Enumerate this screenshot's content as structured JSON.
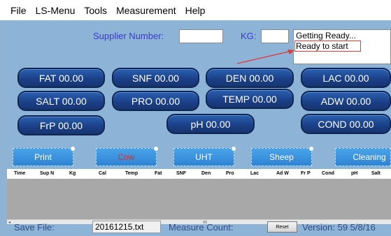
{
  "menu": {
    "items": [
      "File",
      "LS-Menu",
      "Tools",
      "Measurement",
      "Help"
    ]
  },
  "form": {
    "supplier_label": "Supplier Number:",
    "supplier_value": "",
    "kg_label": "KG:",
    "kg_value": ""
  },
  "status": {
    "line1": "Getting Ready...",
    "line2": "Ready to start"
  },
  "readings": {
    "fat": "FAT 00.00",
    "snf": "SNF 00.00",
    "den": "DEN 00.00",
    "lac": "LAC 00.00",
    "salt": "SALT 00.00",
    "pro": "PRO 00.00",
    "temp": "TEMP 00.00",
    "adw": "ADW 00.00",
    "frp": "FrP 00.00",
    "ph": "pH 00.00",
    "cond": "COND 00.00"
  },
  "toolbar": {
    "print": "Print",
    "cow": "Cow",
    "uht": "UHT",
    "sheep": "Sheep",
    "cleaning": "Cleaning"
  },
  "table": {
    "columns": [
      "Time",
      "Sup N",
      "Kg",
      "Cal",
      "Temp",
      "Fat",
      "SNF",
      "Den",
      "Pro",
      "Lac",
      "Ad W",
      "Fr P",
      "Cond",
      "pH",
      "Salt"
    ]
  },
  "footer": {
    "save_file_label": "Save File:",
    "save_file_value": "20161215.txt",
    "measure_count_label": "Measure Count:",
    "reset_label": "Reset",
    "version": "Version: 59  5/8/16"
  },
  "colors": {
    "background": "#8db3d6",
    "pill": "#1b3f86",
    "toolbar_button": "#3a93dc",
    "status_highlight": "#e03a3a",
    "label": "#3a3ad0"
  }
}
